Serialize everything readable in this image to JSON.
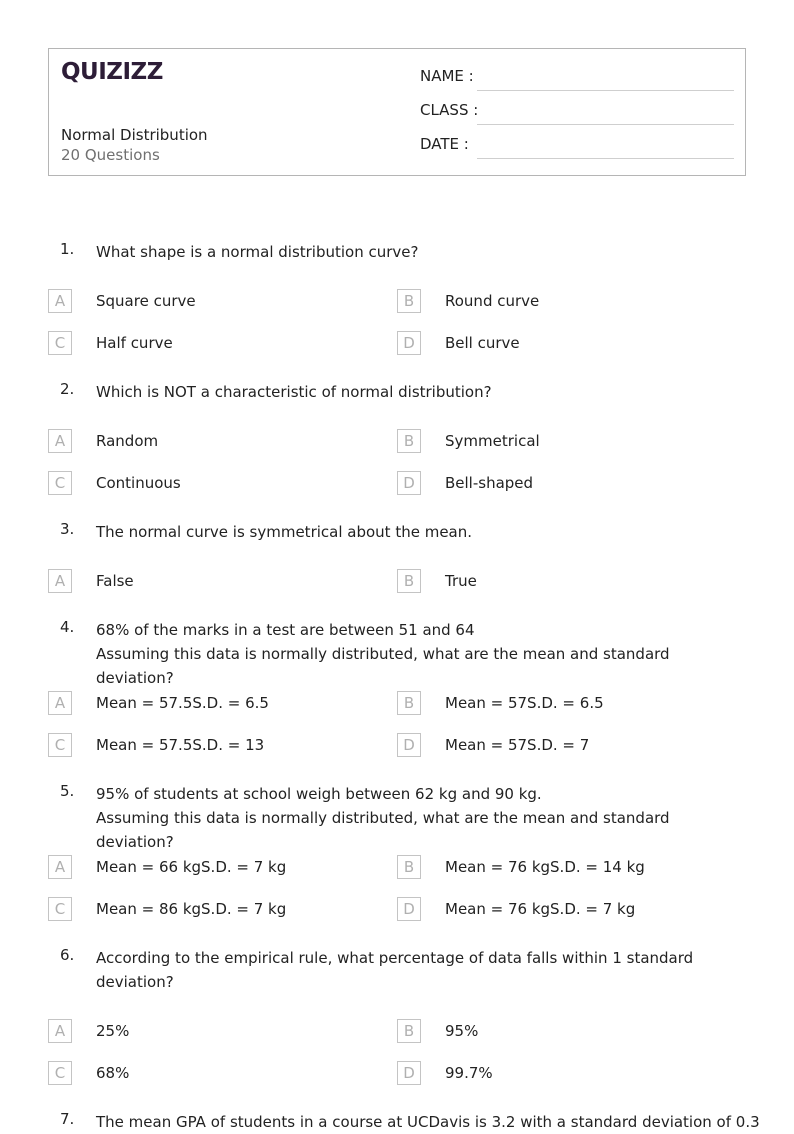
{
  "header": {
    "logo": "QUIZIZZ",
    "title": "Normal Distribution",
    "count": "20 Questions",
    "fields": [
      {
        "label": "NAME :"
      },
      {
        "label": "CLASS :"
      },
      {
        "label": "DATE  :"
      }
    ]
  },
  "questions": [
    {
      "num": "1.",
      "text": "What shape is a normal distribution curve?",
      "options": [
        {
          "letter": "A",
          "text": "Square curve"
        },
        {
          "letter": "B",
          "text": "Round curve"
        },
        {
          "letter": "C",
          "text": "Half curve"
        },
        {
          "letter": "D",
          "text": "Bell curve"
        }
      ]
    },
    {
      "num": "2.",
      "text": "Which is NOT a characteristic of normal distribution?",
      "options": [
        {
          "letter": "A",
          "text": "Random"
        },
        {
          "letter": "B",
          "text": "Symmetrical"
        },
        {
          "letter": "C",
          "text": "Continuous"
        },
        {
          "letter": "D",
          "text": "Bell-shaped"
        }
      ]
    },
    {
      "num": "3.",
      "text": "The normal curve is symmetrical about the mean.",
      "options": [
        {
          "letter": "A",
          "text": "False"
        },
        {
          "letter": "B",
          "text": "True"
        }
      ]
    },
    {
      "num": "4.",
      "text_lines": [
        "68% of the marks in a test are between 51 and 64",
        "Assuming this data is normally distributed, what are the mean and standard deviation?"
      ],
      "options": [
        {
          "letter": "A",
          "text": "Mean = 57.5S.D. = 6.5"
        },
        {
          "letter": "B",
          "text": "Mean = 57S.D. = 6.5"
        },
        {
          "letter": "C",
          "text": "Mean = 57.5S.D. = 13"
        },
        {
          "letter": "D",
          "text": "Mean = 57S.D. = 7"
        }
      ]
    },
    {
      "num": "5.",
      "text_lines": [
        "95% of students at school weigh between 62 kg and 90 kg.",
        "Assuming this data is normally distributed, what are the mean and standard deviation?"
      ],
      "options": [
        {
          "letter": "A",
          "text": "Mean = 66 kgS.D. = 7 kg"
        },
        {
          "letter": "B",
          "text": "Mean = 76 kgS.D. = 14 kg"
        },
        {
          "letter": "C",
          "text": "Mean = 86 kgS.D. = 7 kg"
        },
        {
          "letter": "D",
          "text": "Mean = 76 kgS.D. = 7 kg"
        }
      ]
    },
    {
      "num": "6.",
      "text_lines": [
        "According to the empirical rule, what percentage of data falls within 1 standard",
        "deviation?"
      ],
      "options": [
        {
          "letter": "A",
          "text": "25%"
        },
        {
          "letter": "B",
          "text": "95%"
        },
        {
          "letter": "C",
          "text": "68%"
        },
        {
          "letter": "D",
          "text": "99.7%"
        }
      ]
    },
    {
      "num": "7.",
      "text": "The mean GPA of students in a course at UCDavis is 3.2 with a standard deviation of 0.3"
    }
  ]
}
